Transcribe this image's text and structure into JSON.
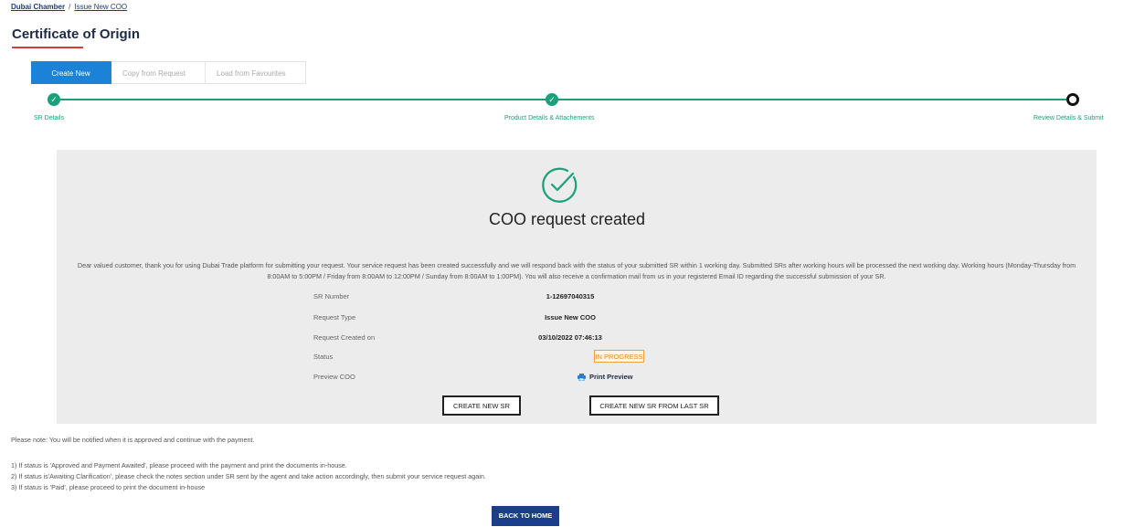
{
  "breadcrumb": {
    "root": "Dubai Chamber",
    "separator": "/",
    "current": "Issue New COO"
  },
  "page_title": "Certificate of Origin",
  "tabs": [
    {
      "label": "Create New",
      "active": true
    },
    {
      "label": "Copy from Request",
      "active": false
    },
    {
      "label": "Load from Favourites",
      "active": false
    }
  ],
  "steps": [
    {
      "label": "SR Details",
      "state": "done"
    },
    {
      "label": "Product Details & Attachements",
      "state": "done"
    },
    {
      "label": "Review Details & Submit",
      "state": "current"
    }
  ],
  "result": {
    "icon": "check-circle-icon",
    "title": "COO request created",
    "message": "Dear valued customer, thank you for using Dubai Trade platform for submitting your request. Your service request has been created successfully and we will respond back with the status of your submitted SR within 1 working day. Submitted SRs after working hours will be processed the next working day. Working hours (Monday-Thursday from 8:00AM to 5:00PM / Friday from 8:00AM to 12:00PM / Sunday from 8:00AM to 1:00PM). You will also receive a confirmation mail from us in your registered Email ID regarding the successful submission of your SR.",
    "details": {
      "sr_number_label": "SR Number",
      "sr_number": "1-12697040315",
      "request_type_label": "Request Type",
      "request_type": "Issue New COO",
      "created_on_label": "Request Created on",
      "created_on": "03/10/2022 07:46:13",
      "status_label": "Status",
      "status": "IN PROGRESS",
      "preview_label": "Preview COO",
      "preview_link": "Print Preview"
    },
    "buttons": {
      "create_new": "CREATE NEW SR",
      "create_from_last": "CREATE NEW SR FROM LAST SR"
    }
  },
  "notes": {
    "intro": "Please note: You will be notified when it is approved and continue with the payment.",
    "items": [
      "1) If status is 'Approved and Payment Awaited', please proceed with the payment and print the documents in-house.",
      "2) If status is'Awaiting Clarification', please check the notes section under SR sent by the agent and take action accordingly, then submit your service request again.",
      "3) If status is 'Paid', please proceed to print the document in-house"
    ]
  },
  "back_button": "BACK TO HOME",
  "colors": {
    "primary": "#1b82d8",
    "success": "#1aa07a",
    "status": "#e08a1c",
    "navy": "#1b3e8c",
    "accent": "#d63b3b"
  }
}
